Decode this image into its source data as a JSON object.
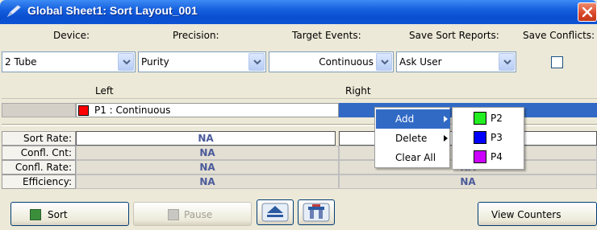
{
  "window": {
    "title": "Global Sheet1: Sort Layout_001"
  },
  "headers": {
    "device": "Device:",
    "precision": "Precision:",
    "target_events": "Target Events:",
    "save_sort_reports": "Save Sort Reports:",
    "save_conflicts": "Save Conflicts:"
  },
  "settings": {
    "device": "2 Tube",
    "precision": "Purity",
    "target_events": "Continuous",
    "save_sort_reports": "Ask User",
    "save_conflicts_checked": false
  },
  "gates": {
    "left_header": "Left",
    "right_header": "Right",
    "left_gate": {
      "label": "P1 : Continuous",
      "color": "#ff0000"
    }
  },
  "stats": {
    "rows": [
      {
        "label": "Sort Rate:",
        "left": "NA",
        "right": ""
      },
      {
        "label": "Confl. Cnt:",
        "left": "NA",
        "right": ""
      },
      {
        "label": "Confl. Rate:",
        "left": "NA",
        "right": "NA"
      },
      {
        "label": "Efficiency:",
        "left": "NA",
        "right": "NA"
      }
    ]
  },
  "context_menu": {
    "items": [
      {
        "label": "Add",
        "has_submenu": true,
        "active": true
      },
      {
        "label": "Delete",
        "has_submenu": true,
        "active": false
      },
      {
        "label": "Clear All",
        "has_submenu": false,
        "active": false
      }
    ],
    "submenu": [
      {
        "label": "P2",
        "color": "#22ee22"
      },
      {
        "label": "P3",
        "color": "#0000ff"
      },
      {
        "label": "P4",
        "color": "#cc00ff"
      }
    ]
  },
  "buttons": {
    "sort": "Sort",
    "pause": "Pause",
    "view_counters": "View Counters"
  },
  "icons": {
    "window": "pencil-icon",
    "close": "close-icon",
    "eject": "eject-icon",
    "device": "tube-holder-icon",
    "sort": "green-square-icon",
    "pause": "gray-square-icon"
  }
}
